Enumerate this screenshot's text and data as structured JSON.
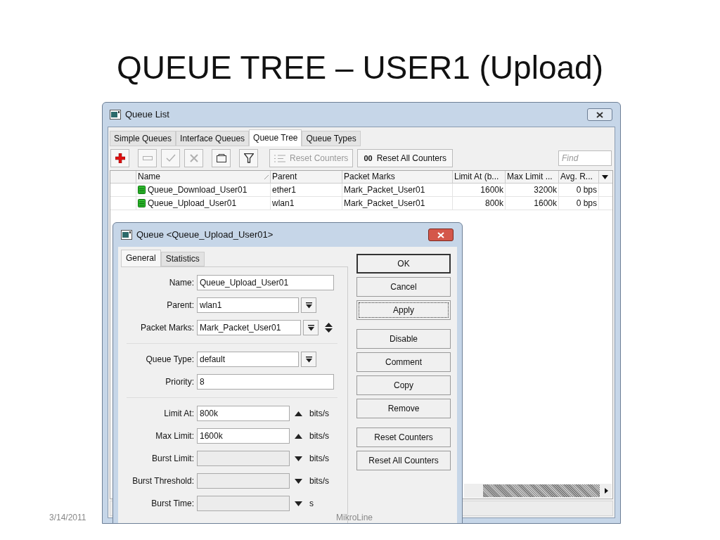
{
  "slide": {
    "title": "QUEUE TREE – USER1 (Upload)",
    "date": "3/14/2011",
    "brand": "MikroLine"
  },
  "queue_list": {
    "title": "Queue List",
    "tabs": [
      {
        "label": "Simple Queues",
        "selected": false
      },
      {
        "label": "Interface Queues",
        "selected": false
      },
      {
        "label": "Queue Tree",
        "selected": true
      },
      {
        "label": "Queue Types",
        "selected": false
      }
    ],
    "tools": [
      {
        "kind": "add",
        "disabled": false
      },
      {
        "kind": "remove",
        "disabled": true
      },
      {
        "kind": "enable",
        "disabled": true
      },
      {
        "kind": "disable",
        "disabled": true
      },
      {
        "kind": "comment",
        "disabled": false
      },
      {
        "kind": "filter",
        "disabled": false
      }
    ],
    "reset_counters": {
      "label": "Reset Counters",
      "disabled": true
    },
    "reset_all": {
      "prefix": "00",
      "label": "Reset All Counters",
      "disabled": false
    },
    "find": {
      "placeholder": "Find"
    },
    "columns": [
      "Name",
      "Parent",
      "Packet Marks",
      "Limit At (b...",
      "Max Limit ...",
      "Avg. R..."
    ],
    "rows": [
      {
        "name": "Queue_Download_User01",
        "parent": "ether1",
        "packet_marks": "Mark_Packet_User01",
        "limit_at": "1600k",
        "max_limit": "3200k",
        "avg_rate": "0 bps"
      },
      {
        "name": "Queue_Upload_User01",
        "parent": "wlan1",
        "packet_marks": "Mark_Packet_User01",
        "limit_at": "800k",
        "max_limit": "1600k",
        "avg_rate": "0 bps"
      }
    ]
  },
  "dialog": {
    "title": "Queue <Queue_Upload_User01>",
    "tabs": [
      {
        "label": "General",
        "selected": true
      },
      {
        "label": "Statistics",
        "selected": false
      }
    ],
    "field_groups": [
      [
        {
          "label": "Name:",
          "value": "Queue_Upload_User01",
          "kind": "text"
        },
        {
          "label": "Parent:",
          "value": "wlan1",
          "kind": "dropdown"
        },
        {
          "label": "Packet Marks:",
          "value": "Mark_Packet_User01",
          "kind": "multi"
        }
      ],
      [
        {
          "label": "Queue Type:",
          "value": "default",
          "kind": "dropdown"
        },
        {
          "label": "Priority:",
          "value": "8",
          "kind": "text"
        }
      ],
      [
        {
          "label": "Limit At:",
          "value": "800k",
          "kind": "rate",
          "unit": "bits/s",
          "disabled": false
        },
        {
          "label": "Max Limit:",
          "value": "1600k",
          "kind": "rate",
          "unit": "bits/s",
          "disabled": false
        },
        {
          "label": "Burst Limit:",
          "kind": "rate",
          "unit": "bits/s",
          "disabled": true
        },
        {
          "label": "Burst Threshold:",
          "kind": "rate",
          "unit": "bits/s",
          "disabled": true
        },
        {
          "label": "Burst Time:",
          "kind": "rate",
          "unit": "s",
          "disabled": true
        }
      ]
    ],
    "button_groups": [
      [
        {
          "label": "OK",
          "default": true,
          "focused": false
        },
        {
          "label": "Cancel",
          "default": false,
          "focused": false
        },
        {
          "label": "Apply",
          "default": false,
          "focused": true
        }
      ],
      [
        {
          "label": "Disable",
          "default": false,
          "focused": false
        },
        {
          "label": "Comment",
          "default": false,
          "focused": false
        },
        {
          "label": "Copy",
          "default": false,
          "focused": false
        },
        {
          "label": "Remove",
          "default": false,
          "focused": false
        }
      ],
      [
        {
          "label": "Reset Counters",
          "default": false,
          "focused": false
        },
        {
          "label": "Reset All Counters",
          "default": false,
          "focused": false
        }
      ]
    ]
  }
}
